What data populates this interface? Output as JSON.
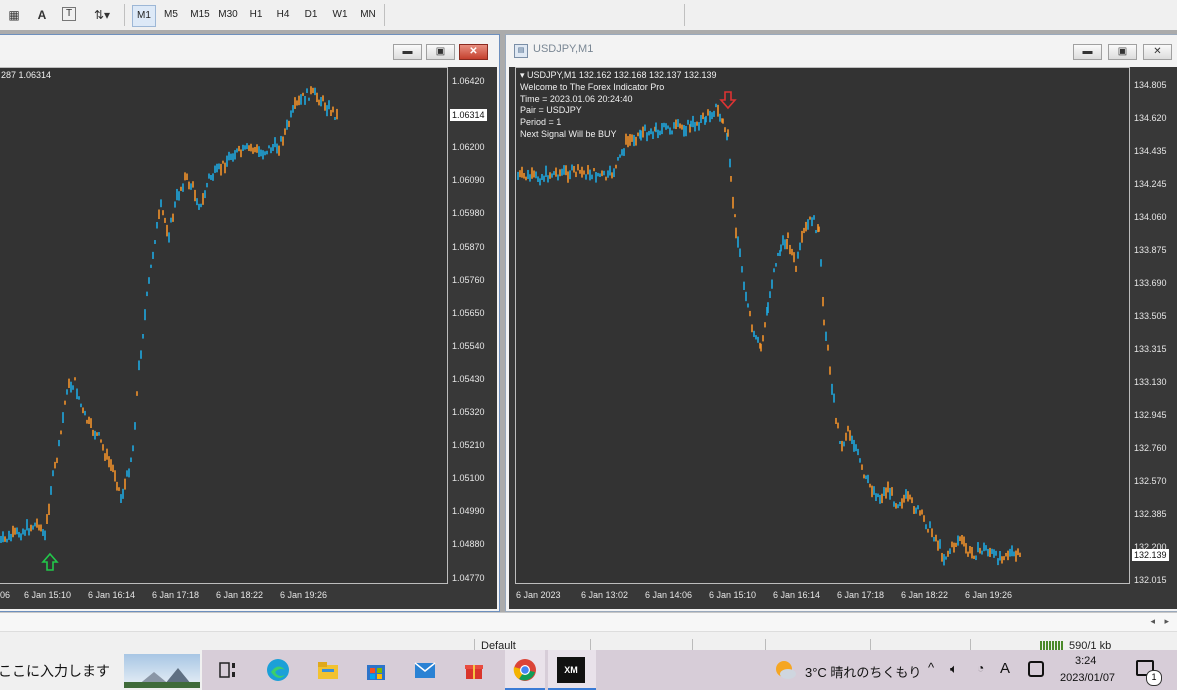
{
  "toolbar": {
    "timeframes": [
      "M1",
      "M5",
      "M15",
      "M30",
      "H1",
      "H4",
      "D1",
      "W1",
      "MN"
    ],
    "selected": "M1"
  },
  "left_window": {
    "info_line": "287 1.06314",
    "price_labels": [
      "1.06420",
      "1.06310",
      "1.06200",
      "1.06090",
      "1.05980",
      "1.05870",
      "1.05760",
      "1.05650",
      "1.05540",
      "1.05430",
      "1.05320",
      "1.05210",
      "1.05100",
      "1.04990",
      "1.04880",
      "1.04770"
    ],
    "current_price": "1.06314",
    "time_labels": [
      "06",
      "6 Jan 15:10",
      "6 Jan 16:14",
      "6 Jan 17:18",
      "6 Jan 18:22",
      "6 Jan 19:26"
    ]
  },
  "right_window": {
    "title": "USDJPY,M1",
    "info_lines": [
      "USDJPY,M1  132.162 132.168 132.137 132.139",
      "Welcome to The Forex Indicator Pro",
      "Time = 2023.01.06 20:24:40",
      "Pair = USDJPY",
      "Period = 1",
      "Next Signal Will be BUY"
    ],
    "price_labels": [
      "134.805",
      "134.620",
      "134.435",
      "134.245",
      "134.060",
      "133.875",
      "133.690",
      "133.505",
      "133.315",
      "133.130",
      "132.945",
      "132.760",
      "132.570",
      "132.385",
      "132.200",
      "132.015"
    ],
    "current_price": "132.139",
    "time_labels": [
      "6 Jan 2023",
      "6 Jan 13:02",
      "6 Jan 14:06",
      "6 Jan 15:10",
      "6 Jan 16:14",
      "6 Jan 17:18",
      "6 Jan 18:22",
      "6 Jan 19:26"
    ]
  },
  "bottombar": {
    "profile": "Default",
    "traffic": "590/1 kb"
  },
  "taskbar": {
    "search_text": "ここに入力します",
    "weather": "3°C  晴れのちくもり",
    "ime": "A",
    "time": "3:24",
    "date": "2023/01/07",
    "notif_count": "1"
  },
  "colors": {
    "up": "#1fa8e0",
    "down": "#f0922a",
    "buy_arrow": "#22c84a",
    "sell_arrow": "#d33"
  }
}
